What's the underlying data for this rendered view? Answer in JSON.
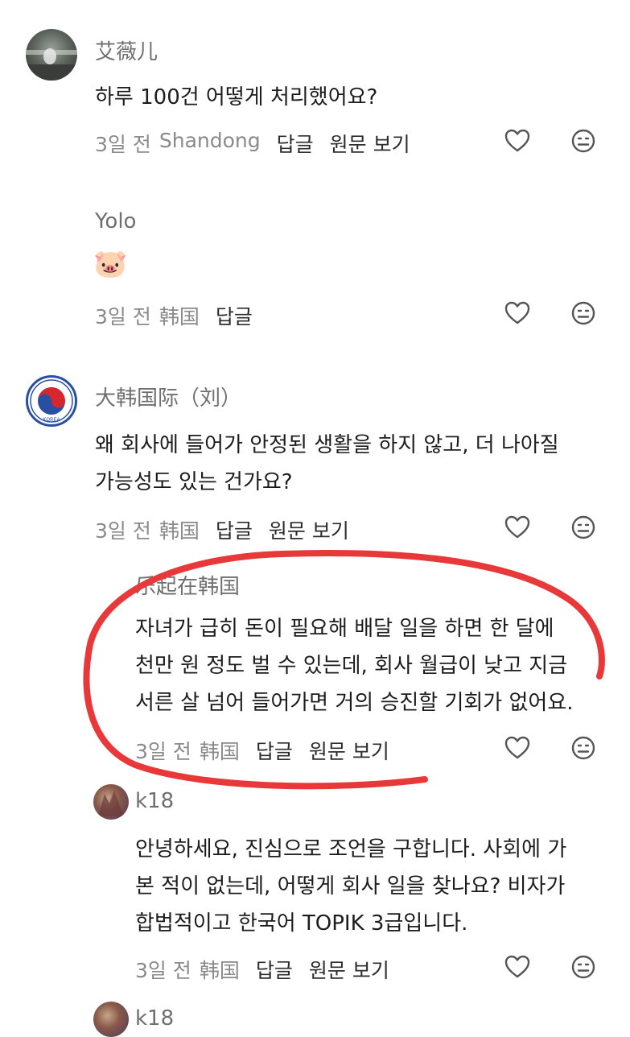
{
  "comments": [
    {
      "username": "艾薇儿",
      "lines": [
        "하루 100건 어떻게 처리했어요?"
      ],
      "time": "3일 전",
      "location": "Shandong",
      "reply_label": "답글",
      "original_label": "원문 보기"
    },
    {
      "username": "Yolo",
      "emoji": "🐷",
      "time": "3일 전",
      "location": "韩国",
      "reply_label": "답글"
    },
    {
      "username": "大韩国际（刘）",
      "lines": [
        "왜 회사에 들어가 안정된 생활을 하지 않고, 더 나아질",
        "가능성도 있는 건가요?"
      ],
      "time": "3일 전",
      "location": "韩国",
      "reply_label": "답글",
      "original_label": "원문 보기",
      "avatar_text": "KOREA"
    },
    {
      "username": "乐起在韩国",
      "lines": [
        "자녀가 급히 돈이 필요해 배달 일을 하면 한 달에",
        "천만 원 정도 벌 수 있는데, 회사 월급이 낮고 지금",
        "서른 살 넘어 들어가면 거의 승진할 기회가 없어요."
      ],
      "time": "3일 전",
      "location": "韩国",
      "reply_label": "답글",
      "original_label": "원문 보기"
    },
    {
      "username": "k18",
      "lines": [
        "안녕하세요, 진심으로 조언을 구합니다. 사회에 가",
        "본 적이 없는데, 어떻게 회사 일을 찾나요? 비자가",
        "합법적이고 한국어 TOPIK 3급입니다."
      ],
      "time": "3일 전",
      "location": "韩国",
      "reply_label": "답글",
      "original_label": "원문 보기"
    },
    {
      "username": "k18"
    }
  ],
  "colors": {
    "annotation": "#e8383a",
    "muted": "#8a8a8a",
    "icon": "#555555"
  },
  "icons": [
    "heart-icon",
    "dislike-face-icon"
  ]
}
